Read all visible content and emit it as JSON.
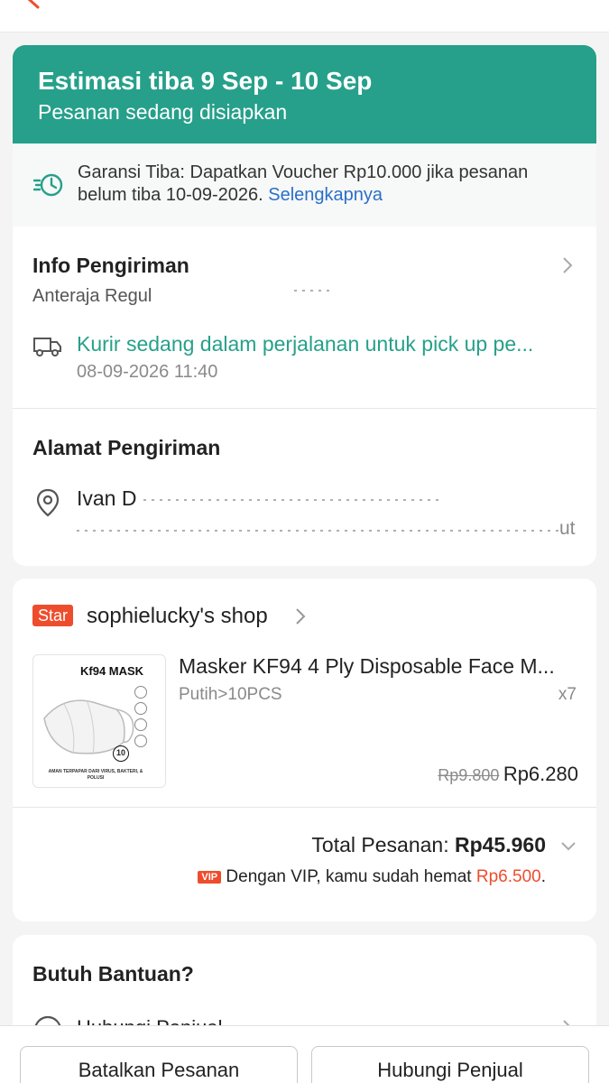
{
  "status": {
    "eta": "Estimasi tiba 9 Sep - 10 Sep",
    "subtitle": "Pesanan sedang disiapkan"
  },
  "guarantee": {
    "text": "Garansi Tiba: Dapatkan Voucher Rp10.000 jika pesanan belum tiba 10-09-2026.",
    "link": "Selengkapnya"
  },
  "shipping": {
    "title": "Info Pengiriman",
    "courier": "Anteraja Regul",
    "tracking_status": "Kurir sedang dalam perjalanan untuk pick up pe...",
    "tracking_time": "08-09-2026 11:40"
  },
  "address": {
    "title": "Alamat Pengiriman",
    "name_visible": "Ivan D",
    "line2_tail": "ut"
  },
  "shop": {
    "badge": "Star",
    "name": "sophielucky's shop",
    "product": {
      "title": "Masker KF94 4 Ply Disposable Face M...",
      "variant": "Putih>10PCS",
      "qty": "x7",
      "price_original": "Rp9.800",
      "price": "Rp6.280",
      "thumb_label": "Kf94 MASK",
      "thumb_pcs": "10",
      "thumb_footer": "AMAN TERPAPAR DARI VIRUS, BAKTERI, & POLUSI"
    },
    "total_label": "Total Pesanan:",
    "total_value": "Rp45.960",
    "vip_badge": "VIP",
    "vip_text": "Dengan VIP, kamu sudah hemat",
    "vip_amount": "Rp6.500",
    "vip_tail": "."
  },
  "help": {
    "title": "Butuh Bantuan?",
    "item_partial": "Hubungi Penjual"
  },
  "actions": {
    "cancel": "Batalkan Pesanan",
    "contact": "Hubungi Penjual"
  },
  "colors": {
    "teal": "#26a08a",
    "brand": "#ee4d2d",
    "link": "#2a6fc9"
  }
}
